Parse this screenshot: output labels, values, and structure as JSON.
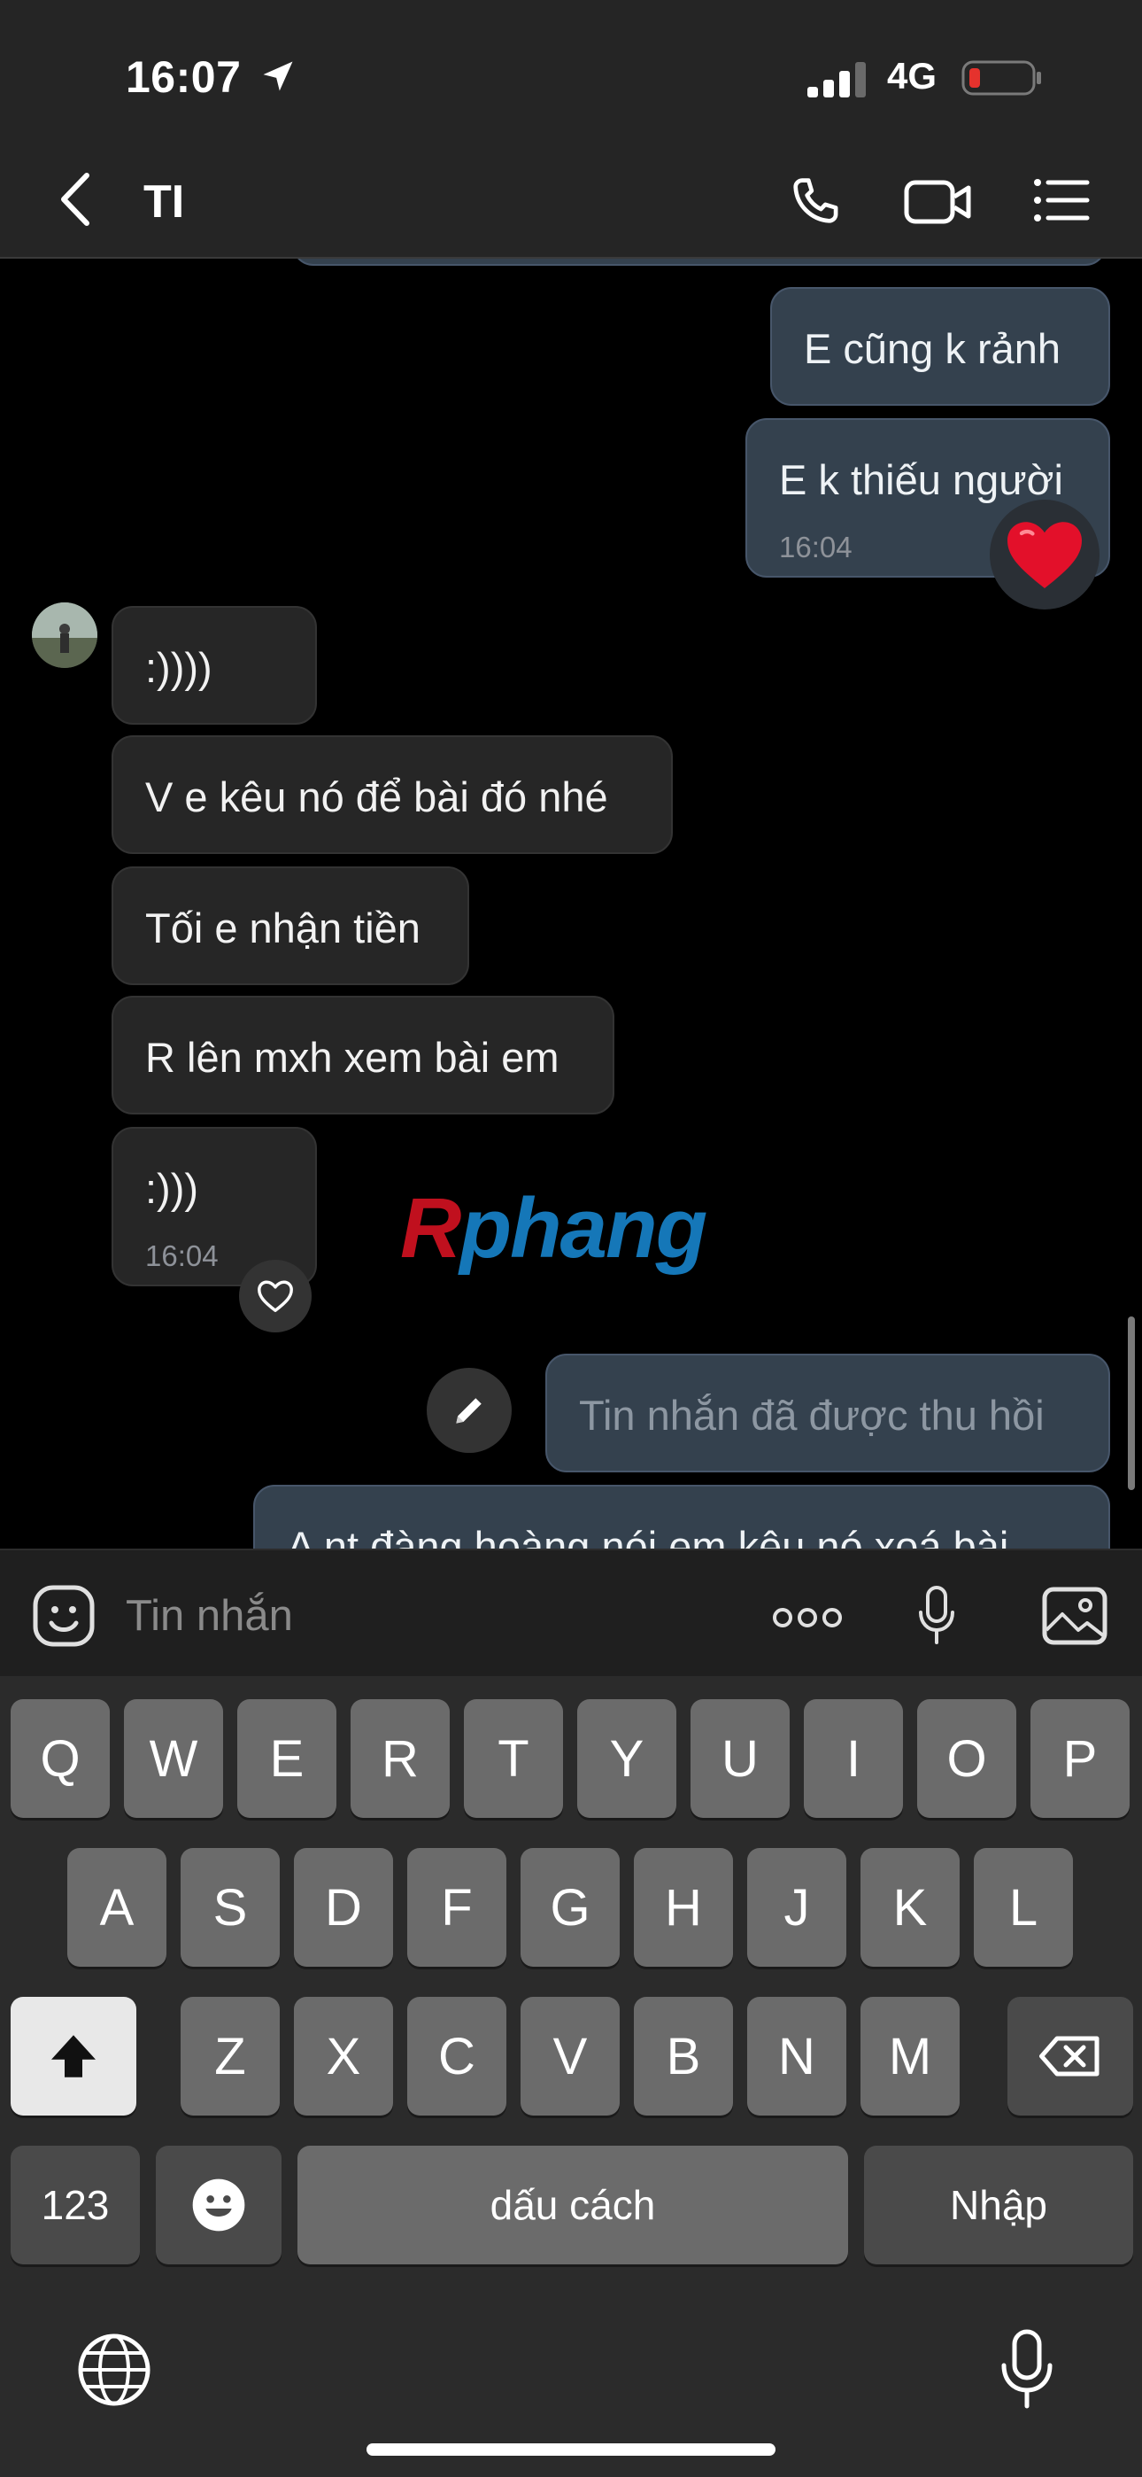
{
  "status_bar": {
    "time": "16:07",
    "network": "4G"
  },
  "header": {
    "contact_name": "TI"
  },
  "messages": {
    "out_1": "E cũng k rảnh",
    "out_2": "E k thiếu người",
    "out_2_time": "16:04",
    "in_1": ":))))",
    "in_2": "V e kêu nó để bài đó nhé",
    "in_3": "Tối e nhận tiền",
    "in_4": "R lên mxh xem bài em",
    "in_5": ":)))",
    "in_5_time": "16:04",
    "recalled": "Tin nhắn đã được thu hồi",
    "out_partial": "A nt đàng hoàng nói em kêu nó xoá bài"
  },
  "watermark": {
    "first": "R",
    "rest": "phang"
  },
  "composer": {
    "placeholder": "Tin nhắn"
  },
  "keyboard": {
    "row1": [
      "Q",
      "W",
      "E",
      "R",
      "T",
      "Y",
      "U",
      "I",
      "O",
      "P"
    ],
    "row2": [
      "A",
      "S",
      "D",
      "F",
      "G",
      "H",
      "J",
      "K",
      "L"
    ],
    "row3": [
      "Z",
      "X",
      "C",
      "V",
      "B",
      "N",
      "M"
    ],
    "numbers": "123",
    "space": "dấu cách",
    "return": "Nhập"
  },
  "colors": {
    "outgoing_bubble": "#34414e",
    "incoming_bubble": "#262626",
    "heart": "#e3102a",
    "battery_low": "#e5322d"
  },
  "icons": [
    "location-arrow-icon",
    "signal-icon",
    "battery-icon",
    "back-chevron-icon",
    "phone-icon",
    "video-icon",
    "list-icon",
    "heart-icon",
    "pencil-icon",
    "emoji-icon",
    "more-dots-icon",
    "mic-icon",
    "image-icon",
    "shift-icon",
    "delete-icon",
    "emoji-key-icon",
    "globe-icon"
  ]
}
